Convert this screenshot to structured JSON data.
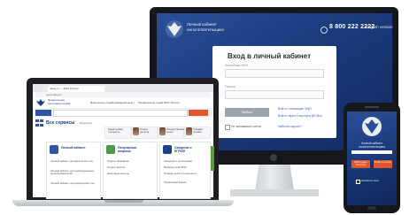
{
  "monitor": {
    "logo_icon": "eagle-emblem-icon",
    "title": "Личный кабинет налогоплательщика",
    "phone_icon": "phone-icon",
    "phone": "8 800 222 2222",
    "lang": "English version",
    "login": {
      "title": "Вход в личный кабинет",
      "login_label": "Логин/Ваш ИНН",
      "password_label": "Пароль",
      "submit_label": "Войти",
      "remember_label": "Не запоминать меня",
      "links": [
        "Войти с помощью ЭЦП",
        "Войти через Госуслуги (ЕСИА)",
        "Забыли пароль?"
      ]
    }
  },
  "laptop": {
    "tab_title": "nalog.ru — ФНС России",
    "url": "www.nalog.ru",
    "site": {
      "name": "Федеральная налоговая служба",
      "nav": [
        "Физические лица",
        "Индивидуальные предприниматели",
        "Юридические лица",
        "О ФНС России"
      ],
      "services_title": "Все сервисы",
      "services_sub": "Госуслуги",
      "banners": [
        "Кадастровая стоимость",
        "Уплата налогов",
        "Имущественный вычет",
        "Справки онлайн"
      ],
      "cards": [
        {
          "icon": "user-icon",
          "title": "Личный кабинет",
          "items": [
            "Личный кабинет для физических лиц",
            "Личный кабинет для индивидуальных предпринимателей",
            "Личный кабинет для юридических лиц"
          ]
        },
        {
          "icon": "chat-icon",
          "title": "Популярные вопросы",
          "items": [
            "Подать обращение",
            "Уплата налогов",
            "Налоговые вычеты"
          ]
        },
        {
          "icon": "document-icon",
          "title": "Сведения о ЕГРЮЛ",
          "items": [
            "Сведения о регистрации",
            "Выписка из ЕГРЮЛ",
            "Проверь себя и контрагента",
            "Прозрачный бизнес"
          ]
        }
      ]
    }
  },
  "phone": {
    "logo_icon": "eagle-emblem-icon",
    "title": "Личный кабинет налогоплательщика",
    "buttons": [
      "Войти через Госуслуги",
      "Войти по логину"
    ],
    "remember_label": "Запомнить меня"
  },
  "colors": {
    "brand_blue": "#1f3f8a",
    "accent_orange": "#e2582a",
    "green": "#5a9c3a"
  }
}
